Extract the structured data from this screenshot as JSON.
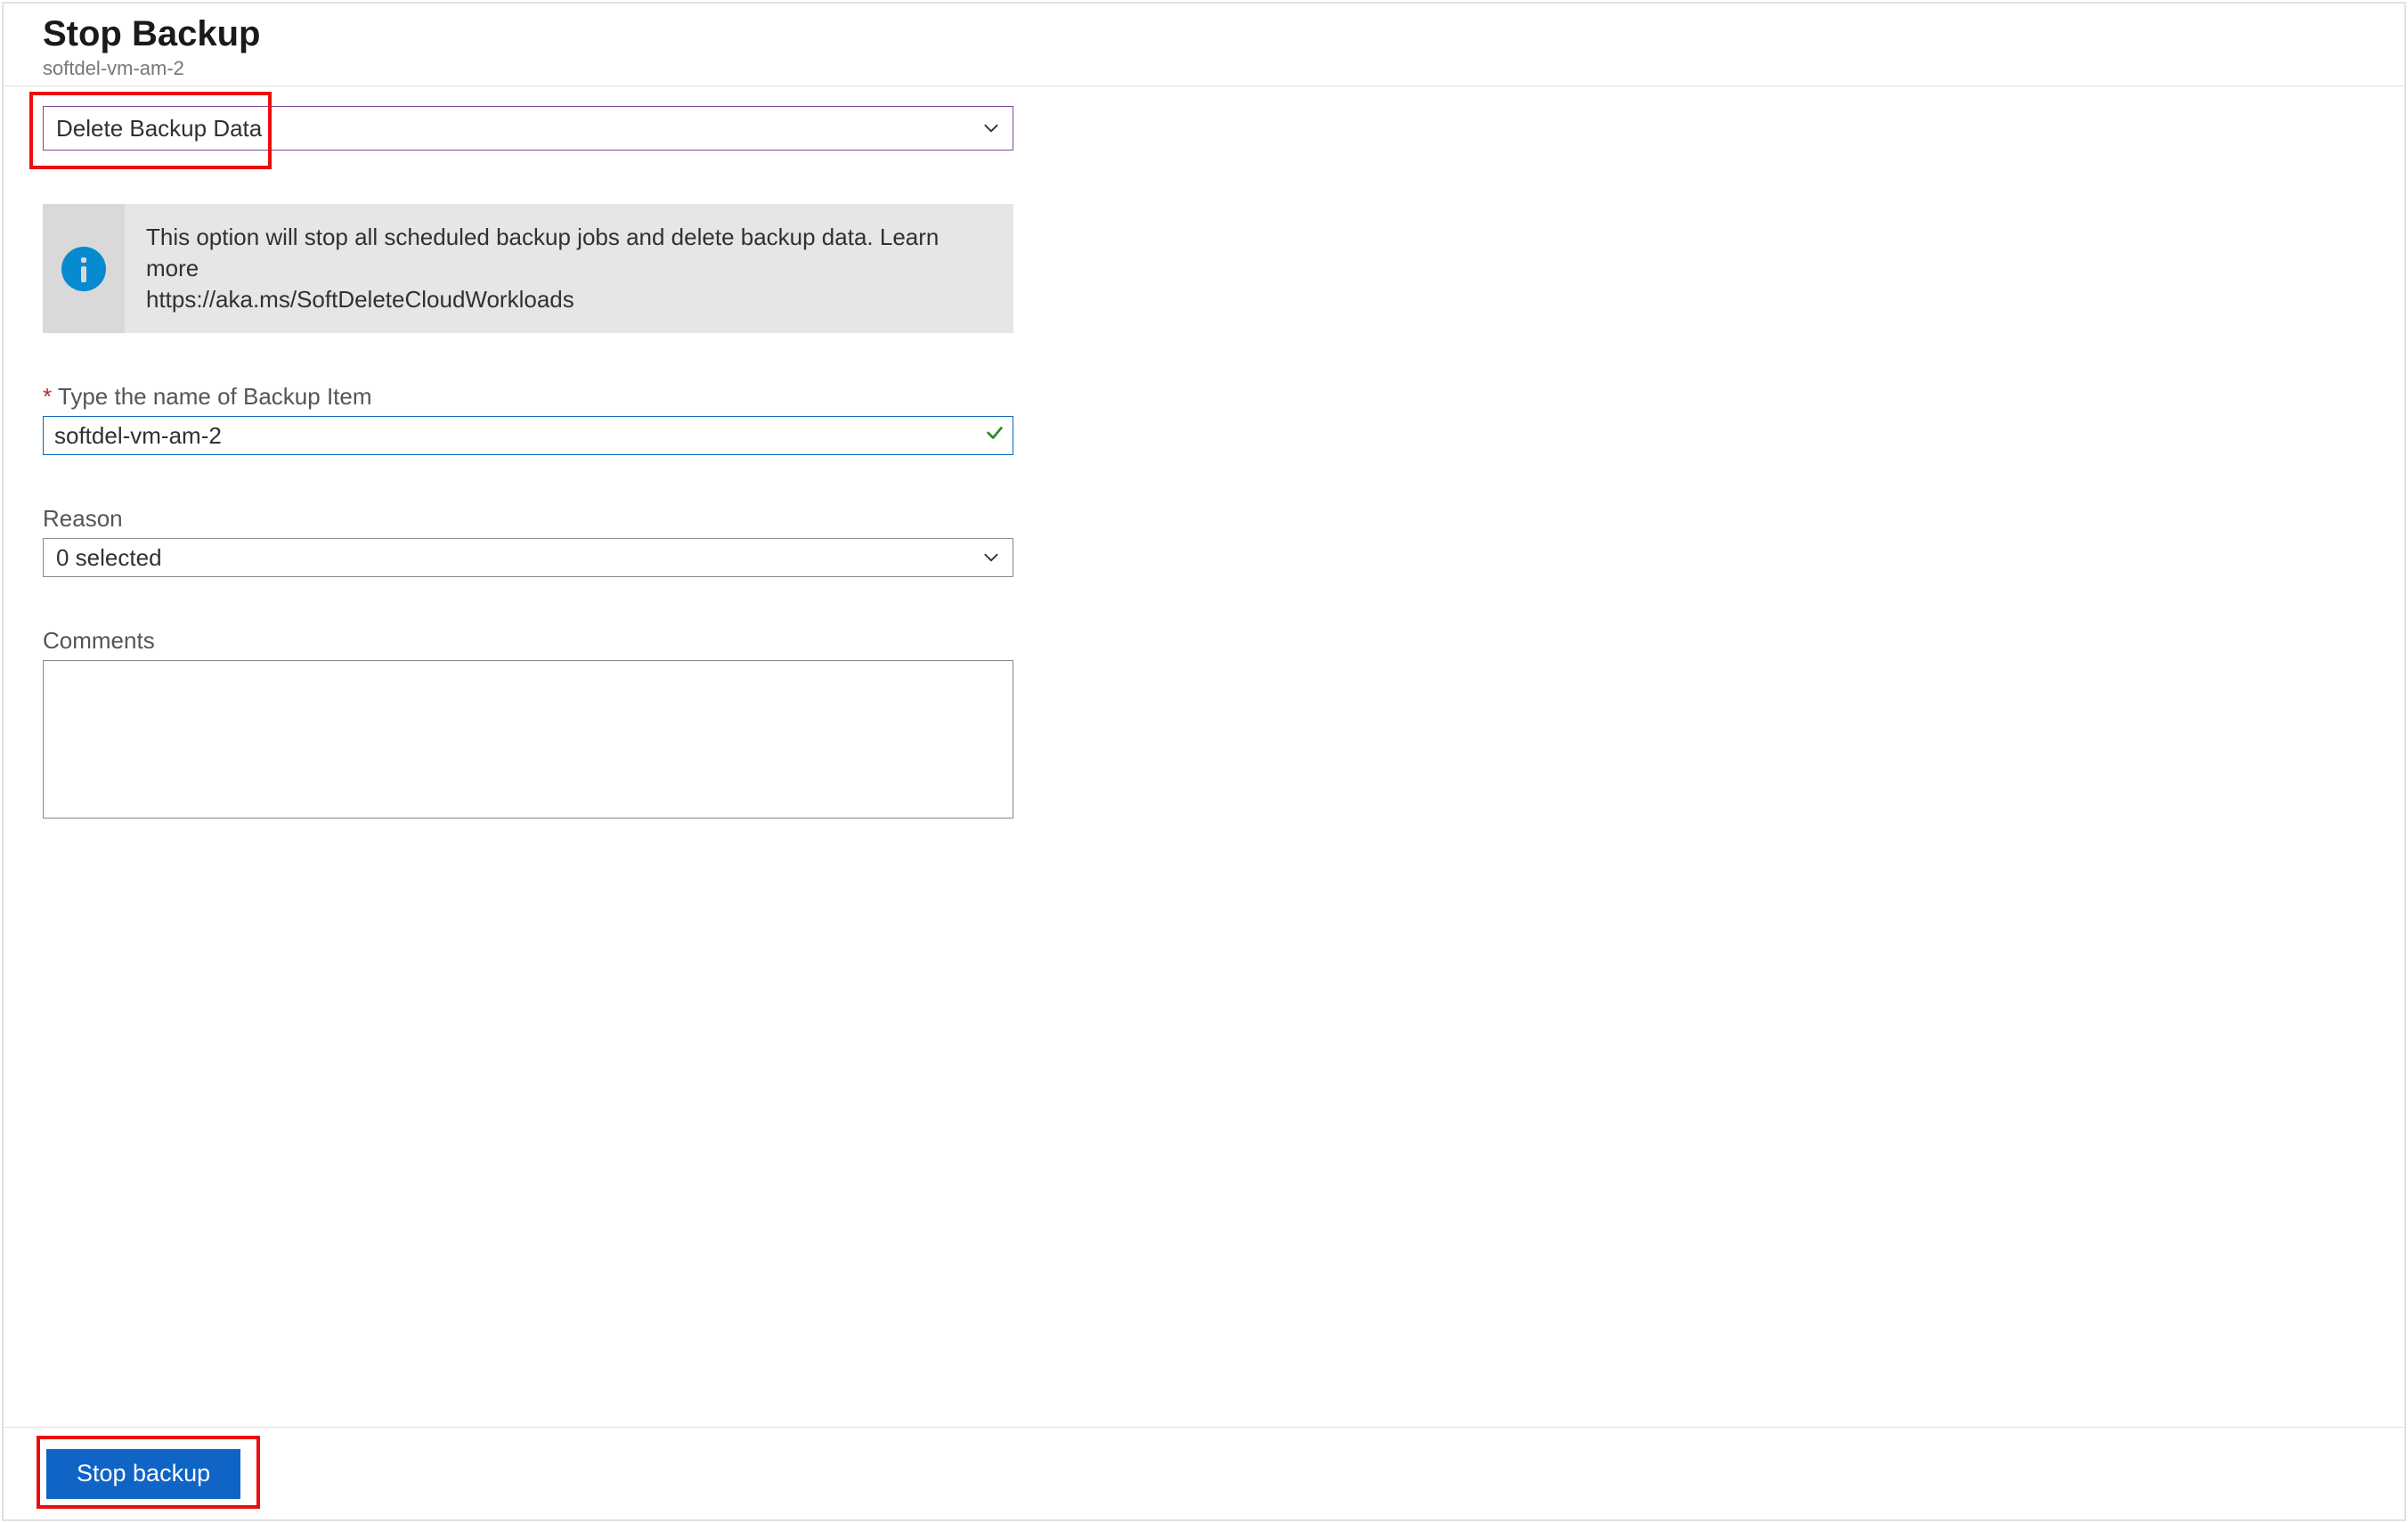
{
  "header": {
    "title": "Stop Backup",
    "subtitle": "softdel-vm-am-2"
  },
  "action_dropdown": {
    "selected": "Delete Backup Data"
  },
  "info": {
    "text": "This option will stop all scheduled backup jobs and delete backup data. Learn more",
    "link": "https://aka.ms/SoftDeleteCloudWorkloads"
  },
  "fields": {
    "name_label": "Type the name of Backup Item",
    "name_value": "softdel-vm-am-2",
    "reason_label": "Reason",
    "reason_value": "0 selected",
    "comments_label": "Comments",
    "comments_value": ""
  },
  "footer": {
    "submit_label": "Stop backup"
  }
}
